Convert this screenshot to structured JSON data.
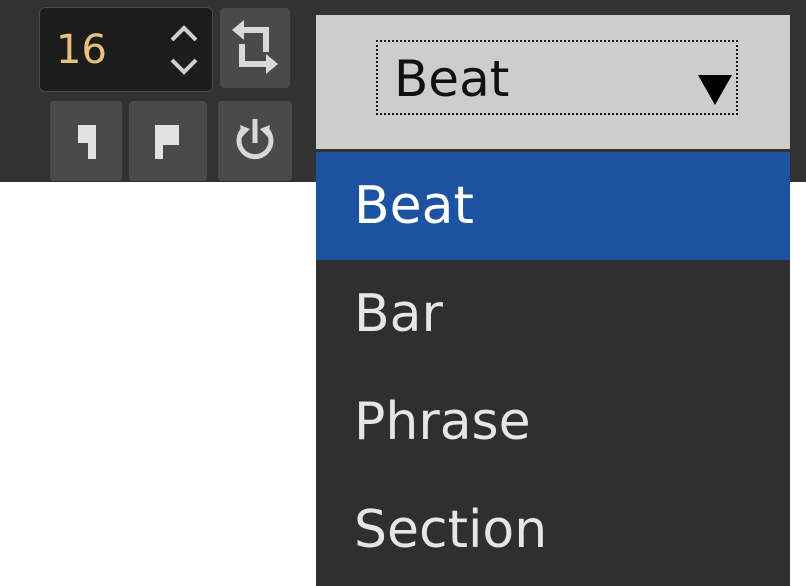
{
  "spinbox": {
    "value": "16",
    "arrows_icon": "chevron-up-down-icon"
  },
  "toolbar": {
    "buttons": [
      {
        "name": "loop-icon"
      },
      {
        "name": "cue-out-flag-icon"
      },
      {
        "name": "cue-in-flag-icon"
      },
      {
        "name": "sync-power-icon"
      }
    ]
  },
  "combo": {
    "selected": "Beat",
    "arrow_icon": "triangle-down-icon"
  },
  "menu": {
    "items": [
      {
        "label": "Beat",
        "selected": true
      },
      {
        "label": "Bar",
        "selected": false
      },
      {
        "label": "Phrase",
        "selected": false
      },
      {
        "label": "Section",
        "selected": false
      }
    ]
  },
  "colors": {
    "toolbar_bg": "#323232",
    "menu_bg": "#2f2f2f",
    "selected_bg": "#1c52a0",
    "spin_value": "#e8c27c",
    "combo_bg": "#cdcdcd"
  }
}
